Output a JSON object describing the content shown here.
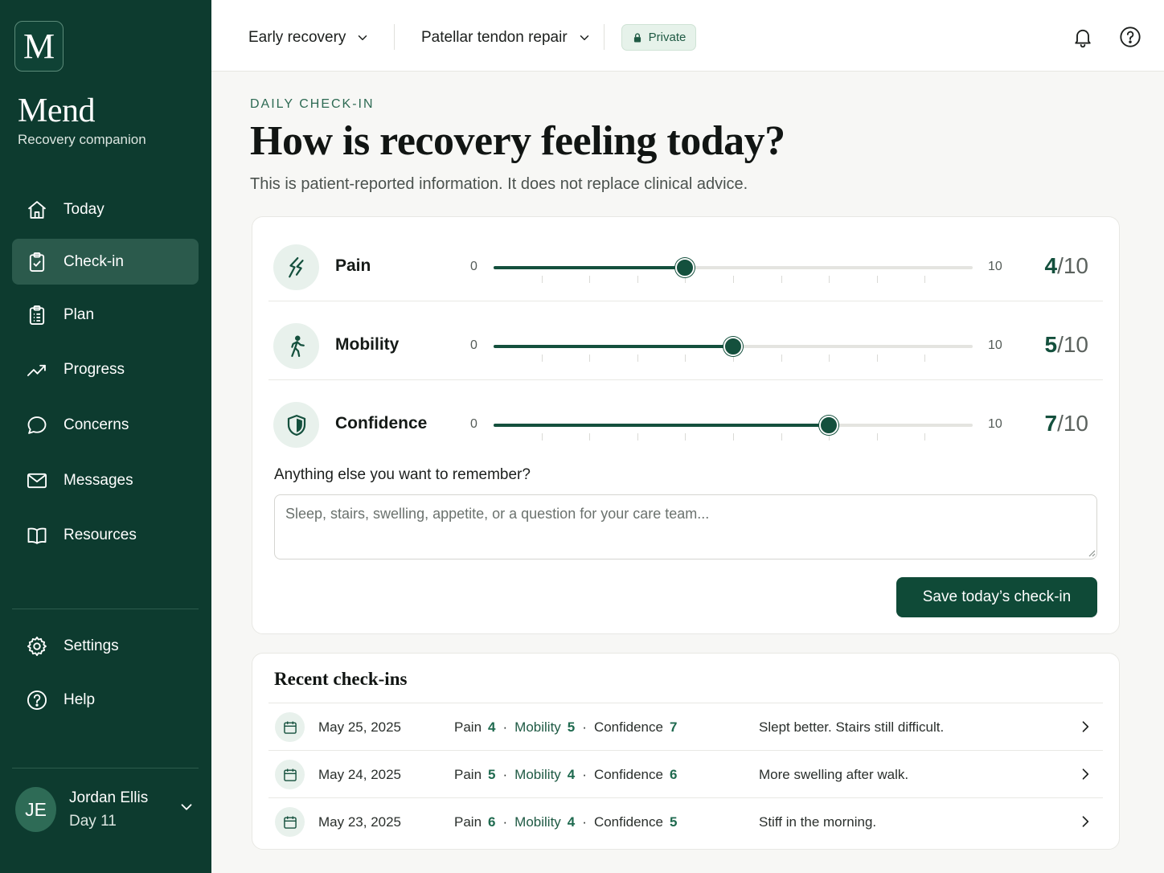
{
  "app": {
    "logo_letter": "M",
    "name": "Mend",
    "tagline": "Recovery companion"
  },
  "sidebar": {
    "items": [
      {
        "label": "Today",
        "icon": "home-icon",
        "active": false
      },
      {
        "label": "Check-in",
        "icon": "clipboard-check-icon",
        "active": true
      },
      {
        "label": "Plan",
        "icon": "clipboard-list-icon",
        "active": false
      },
      {
        "label": "Progress",
        "icon": "trend-up-icon",
        "active": false
      },
      {
        "label": "Concerns",
        "icon": "chat-bubble-icon",
        "active": false
      },
      {
        "label": "Messages",
        "icon": "mail-icon",
        "active": false
      },
      {
        "label": "Resources",
        "icon": "book-icon",
        "active": false
      }
    ],
    "footer_items": [
      {
        "label": "Settings",
        "icon": "gear-icon"
      },
      {
        "label": "Help",
        "icon": "help-circle-icon"
      }
    ],
    "user": {
      "initials": "JE",
      "name": "Jordan Ellis",
      "day": "Day 11"
    }
  },
  "topbar": {
    "phase": "Early recovery",
    "procedure": "Patellar tendon repair",
    "privacy": "Private"
  },
  "page": {
    "eyebrow": "DAILY CHECK-IN",
    "title": "How is recovery feeling today?",
    "subtitle": "This is patient-reported information. It does not replace clinical advice."
  },
  "checkin": {
    "scale_min": "0",
    "scale_max": "10",
    "metrics": [
      {
        "label": "Pain",
        "value": 4,
        "value_text": "4",
        "of": "/10",
        "icon": "pain-bolt-icon"
      },
      {
        "label": "Mobility",
        "value": 5,
        "value_text": "5",
        "of": "/10",
        "icon": "walking-icon"
      },
      {
        "label": "Confidence",
        "value": 7,
        "value_text": "7",
        "of": "/10",
        "icon": "shield-icon"
      }
    ],
    "notes_label": "Anything else you want to remember?",
    "notes_placeholder": "Sleep, stairs, swelling, appetite, or a question for your care team...",
    "notes_value": "",
    "save_label": "Save today’s check-in"
  },
  "recent": {
    "title": "Recent check-ins",
    "labels": {
      "pain": "Pain",
      "mobility": "Mobility",
      "confidence": "Confidence"
    },
    "entries": [
      {
        "date": "May 25, 2025",
        "pain": "4",
        "mobility": "5",
        "confidence": "7",
        "note": "Slept better. Stairs still difficult."
      },
      {
        "date": "May 24, 2025",
        "pain": "5",
        "mobility": "4",
        "confidence": "6",
        "note": "More swelling after walk."
      },
      {
        "date": "May 23, 2025",
        "pain": "6",
        "mobility": "4",
        "confidence": "5",
        "note": "Stiff in the morning."
      }
    ]
  },
  "colors": {
    "sidebar_bg": "#0d3b2f",
    "accent": "#14503d",
    "accent_soft": "#e8f1ec",
    "page_bg": "#f7f7f5"
  }
}
